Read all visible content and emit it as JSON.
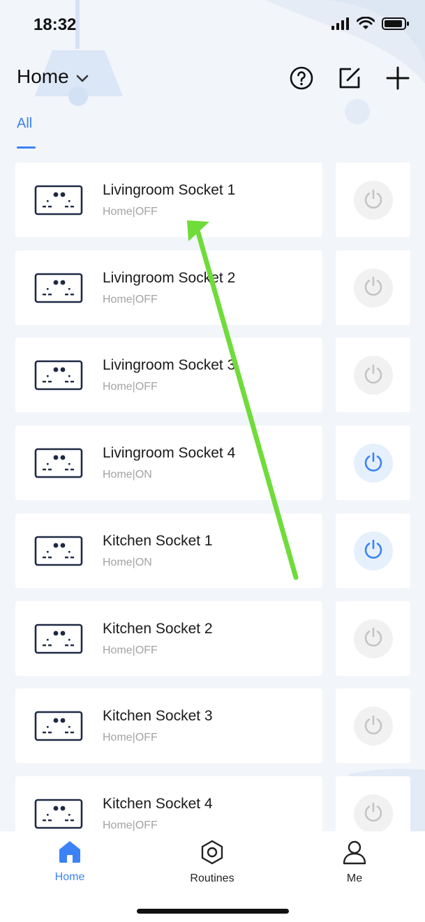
{
  "status": {
    "time": "18:32"
  },
  "header": {
    "title": "Home"
  },
  "tabs": [
    {
      "label": "All"
    }
  ],
  "devices": [
    {
      "name": "Livingroom Socket 1",
      "status": "Home|OFF",
      "on": false
    },
    {
      "name": "Livingroom Socket 2",
      "status": "Home|OFF",
      "on": false
    },
    {
      "name": "Livingroom Socket 3",
      "status": "Home|OFF",
      "on": false
    },
    {
      "name": "Livingroom Socket 4",
      "status": "Home|ON",
      "on": true
    },
    {
      "name": "Kitchen Socket 1",
      "status": "Home|ON",
      "on": true
    },
    {
      "name": "Kitchen Socket 2",
      "status": "Home|OFF",
      "on": false
    },
    {
      "name": "Kitchen Socket 3",
      "status": "Home|OFF",
      "on": false
    },
    {
      "name": "Kitchen Socket 4",
      "status": "Home|OFF",
      "on": false
    }
  ],
  "tabbar": {
    "home": "Home",
    "routines": "Routines",
    "me": "Me"
  },
  "colors": {
    "accent": "#3b82f6",
    "annotation_arrow": "#6fdc3a"
  },
  "icons": {
    "header": [
      "help-icon",
      "edit-icon",
      "plus-icon"
    ],
    "tabbar": [
      "home-icon",
      "routines-icon",
      "person-icon"
    ],
    "device": "socket-icon",
    "toggle": "power-icon"
  }
}
